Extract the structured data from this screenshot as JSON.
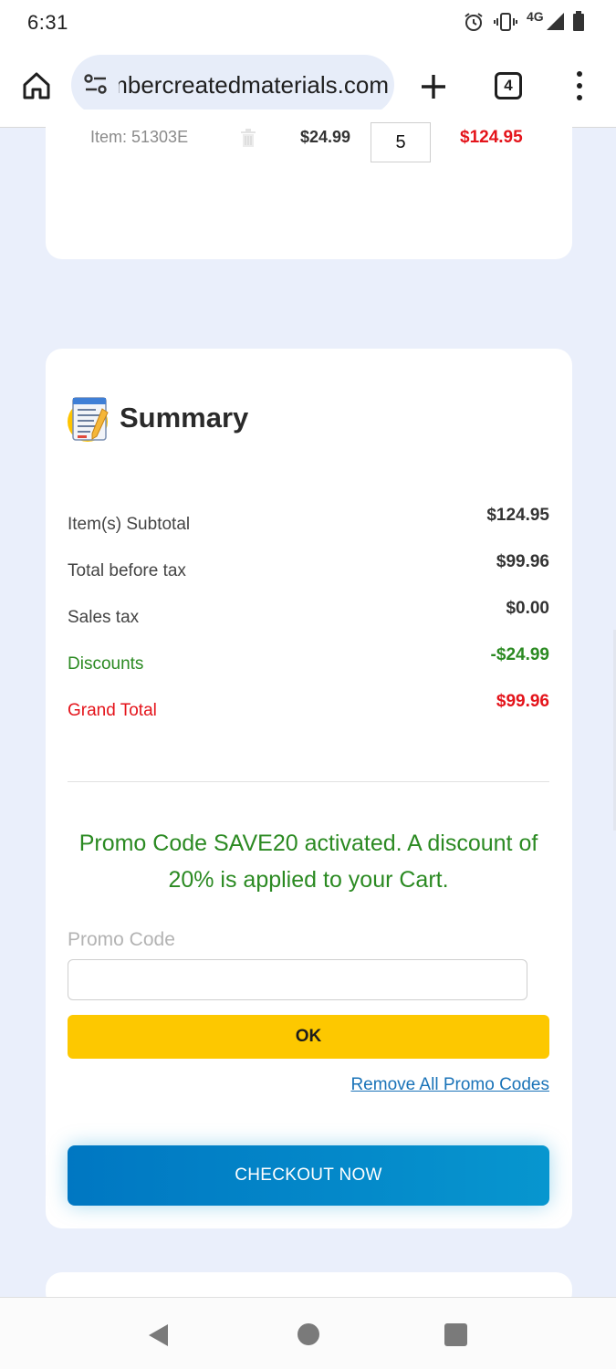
{
  "status_bar": {
    "time": "6:31",
    "network": "4G",
    "icons": [
      "alarm-icon",
      "vibrate-icon",
      "signal-icon",
      "battery-icon"
    ]
  },
  "browser": {
    "url": "numbercreatedmaterials.com",
    "tab_count": "4",
    "icons": [
      "home-icon",
      "site-settings-icon",
      "new-tab-icon",
      "tabs-icon",
      "more-menu-icon"
    ]
  },
  "cart_item": {
    "item_code": "Item: 51303E",
    "unit_price": "$24.99",
    "quantity": "5",
    "line_total": "$124.95"
  },
  "summary": {
    "title": "Summary",
    "rows": [
      {
        "label": "Item(s) Subtotal",
        "value": "$124.95"
      },
      {
        "label": "Total before tax",
        "value": "$99.96"
      },
      {
        "label": "Sales tax",
        "value": "$0.00"
      },
      {
        "label": "Discounts",
        "value": "-$24.99"
      },
      {
        "label": "Grand Total",
        "value": "$99.96"
      }
    ],
    "promo_message": "Promo Code SAVE20 activated. A discount of 20% is applied to your Cart.",
    "promo_label": "Promo Code",
    "promo_value": "",
    "ok_label": "OK",
    "remove_link": "Remove All Promo Codes",
    "checkout_label": "CHECKOUT NOW"
  },
  "colors": {
    "accent_red": "#e4141b",
    "discount_green": "#2b8a22",
    "ok_yellow": "#fdc800",
    "checkout_blue": "#0077c2",
    "page_bg": "#eaeffb"
  }
}
